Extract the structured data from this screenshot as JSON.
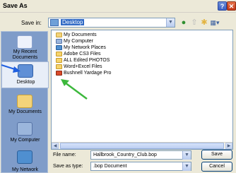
{
  "window": {
    "title": "Save As",
    "help_glyph": "?",
    "close_glyph": "✕"
  },
  "save_in": {
    "label": "Save in:",
    "value": "Desktop"
  },
  "places": [
    {
      "label": "My Recent Documents",
      "icon": "recent-documents-icon"
    },
    {
      "label": "Desktop",
      "icon": "desktop-icon",
      "selected": true
    },
    {
      "label": "My Documents",
      "icon": "my-documents-icon"
    },
    {
      "label": "My Computer",
      "icon": "my-computer-icon"
    },
    {
      "label": "My Network",
      "icon": "my-network-icon"
    }
  ],
  "files": [
    {
      "name": "My Documents",
      "icon": "folder-docs-icon"
    },
    {
      "name": "My Computer",
      "icon": "computer-icon"
    },
    {
      "name": "My Network Places",
      "icon": "network-places-icon"
    },
    {
      "name": "Adobe CS3 Files",
      "icon": "folder-icon"
    },
    {
      "name": "ALL Edited PHOTOS",
      "icon": "folder-icon"
    },
    {
      "name": "Word+Excel Files",
      "icon": "folder-icon"
    },
    {
      "name": "Bushnell Yardage Pro",
      "icon": "app-icon"
    }
  ],
  "file_name": {
    "label": "File name:",
    "value": "Hallbrook_Country_Club.bop"
  },
  "save_as_type": {
    "label": "Save as type:",
    "value": ".bop Document"
  },
  "buttons": {
    "save": "Save",
    "cancel": "Cancel"
  },
  "colors": {
    "annotation_arrow_blue": "#1f5fe0",
    "annotation_arrow_green": "#3cb83c"
  }
}
